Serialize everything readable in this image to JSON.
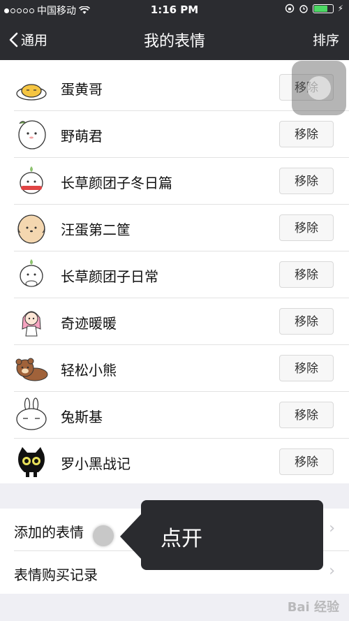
{
  "status_bar": {
    "carrier": "中国移动",
    "time": "1:16 PM"
  },
  "nav": {
    "back_label": "通用",
    "title": "我的表情",
    "right_label": "排序"
  },
  "stickers": [
    {
      "name": "蛋黄哥",
      "action": "移除",
      "icon": "egg-character-icon"
    },
    {
      "name": "野萌君",
      "action": "移除",
      "icon": "cute-creature-icon"
    },
    {
      "name": "长草颜团子冬日篇",
      "action": "移除",
      "icon": "dumpling-winter-icon"
    },
    {
      "name": "汪蛋第二筐",
      "action": "移除",
      "icon": "egg-dog-icon"
    },
    {
      "name": "长草颜团子日常",
      "action": "移除",
      "icon": "dumpling-daily-icon"
    },
    {
      "name": "奇迹暖暖",
      "action": "移除",
      "icon": "girl-character-icon"
    },
    {
      "name": "轻松小熊",
      "action": "移除",
      "icon": "bear-icon"
    },
    {
      "name": "兔斯基",
      "action": "移除",
      "icon": "rabbit-icon"
    },
    {
      "name": "罗小黑战记",
      "action": "移除",
      "icon": "black-cat-icon"
    }
  ],
  "settings": [
    {
      "label": "添加的表情"
    },
    {
      "label": "表情购买记录"
    }
  ],
  "tooltip": {
    "text": "点开"
  },
  "watermark": "Bai 经验"
}
